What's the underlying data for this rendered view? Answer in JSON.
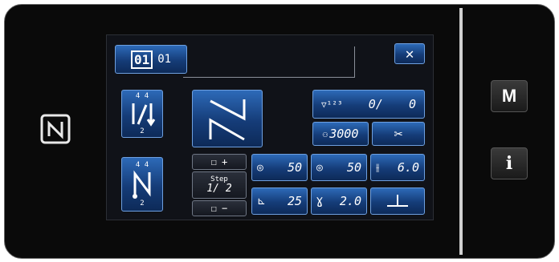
{
  "screen": {
    "pattern_button": {
      "label_a": "01",
      "label_b": "01"
    },
    "close_button": {
      "label": "✕"
    },
    "counter": {
      "value": "0/",
      "value2": "0"
    },
    "speed": {
      "value": "3000"
    },
    "step": {
      "label": "Step",
      "value": "1/ 2",
      "plus_label": "+",
      "minus_label": "−"
    },
    "left_tension": {
      "value": "50"
    },
    "right_tension": {
      "value": "50"
    },
    "stitch_length": {
      "value": "6.0"
    },
    "presser_foot": {
      "value": "25"
    },
    "wiper": {
      "value": "2.0"
    },
    "sub_number_4_4": "4  4",
    "sub_number_2": "2"
  },
  "side_panel": {
    "menu_label": "M",
    "info_label": "i"
  }
}
